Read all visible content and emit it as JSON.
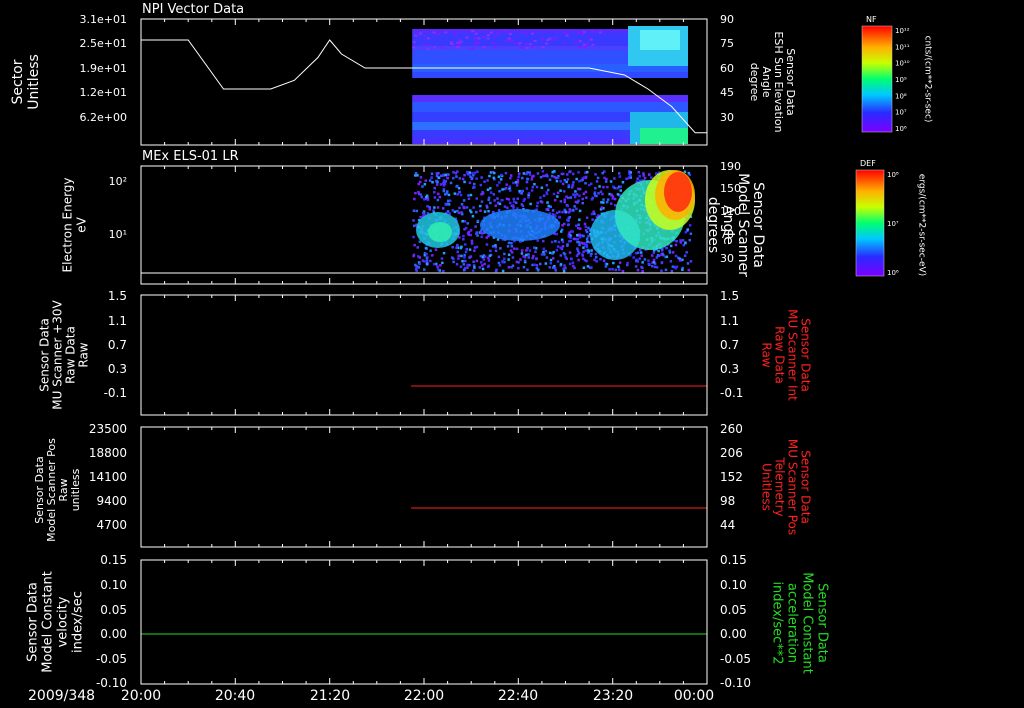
{
  "colors": {
    "background": "#000000",
    "frame": "#ffffff",
    "red_trace": "#ff2020",
    "green_trace": "#22dd22"
  },
  "time_axis": {
    "date_label": "2009/348",
    "ticks": [
      "20:00",
      "20:40",
      "21:20",
      "22:00",
      "22:40",
      "23:20",
      "00:00"
    ]
  },
  "chart_data": [
    {
      "type": "heatmap",
      "title": "NPI Vector Data",
      "ylabel_lines": [
        "Sector",
        "Unitless"
      ],
      "yticks": [
        "3.1e+01",
        "2.5e+01",
        "1.9e+01",
        "1.2e+01",
        "6.2e+00"
      ],
      "y2label_lines": [
        "Sensor Data",
        "ESH Sun Elevation",
        "Angle",
        "degree"
      ],
      "y2ticks": [
        "90",
        "75",
        "60",
        "45",
        "30"
      ],
      "y2lim": [
        18,
        90
      ],
      "colorbar": {
        "title": "NF",
        "unit": "cnts/(cm**2-sr-sec)",
        "ticks": [
          "10¹²",
          "10¹¹",
          "10¹⁰",
          "10⁹",
          "10⁸",
          "10⁷",
          "10⁶"
        ]
      },
      "data_start_time": "21:55",
      "line_series": {
        "name": "ESH Sun Elevation Angle",
        "times": [
          "20:00",
          "20:20",
          "20:35",
          "20:55",
          "21:05",
          "21:15",
          "21:20",
          "21:25",
          "21:35",
          "21:55",
          "22:30",
          "23:10",
          "23:25",
          "23:35",
          "23:45",
          "23:55",
          "00:00"
        ],
        "values": [
          78,
          78,
          50,
          50,
          55,
          68,
          78,
          70,
          62,
          62,
          62,
          62,
          58,
          50,
          40,
          25,
          25
        ]
      }
    },
    {
      "type": "heatmap",
      "title": "MEx ELS-01 LR",
      "ylabel_lines": [
        "Electron Energy",
        "eV"
      ],
      "yticks": [
        "10²",
        "10¹"
      ],
      "y2label_lines": [
        "Sensor Data",
        "Model Scanner",
        "Angle",
        "degrees"
      ],
      "y2ticks": [
        "190",
        "150",
        "110",
        "70",
        "30"
      ],
      "colorbar": {
        "title": "DEF",
        "unit": "ergs/(cm**2-sr-sec-eV)",
        "ticks": [
          "10⁸",
          "10⁷",
          "10⁶"
        ]
      },
      "data_start_time": "21:55",
      "line_series": {
        "name": "Model Scanner Angle",
        "value": 0
      }
    },
    {
      "type": "line",
      "ylabel_lines": [
        "Sensor Data",
        "MU Scanner +30V",
        "Raw Data",
        "Raw"
      ],
      "yticks": [
        "1.5",
        "1.1",
        "0.7",
        "0.3",
        "-0.1"
      ],
      "ylim": [
        -0.5,
        1.5
      ],
      "y2label_lines": [
        "Sensor Data",
        "MU Scanner Int",
        "Raw Data",
        "Raw"
      ],
      "y2ticks": [
        "1.5",
        "1.1",
        "0.7",
        "0.3",
        "-0.1"
      ],
      "series": [
        {
          "start": "21:55",
          "end": "00:00",
          "value": 0.0
        }
      ]
    },
    {
      "type": "line",
      "ylabel_lines": [
        "Sensor Data",
        "Model Scanner Pos",
        "Raw",
        "unitless"
      ],
      "yticks": [
        "23500",
        "18800",
        "14100",
        "9400",
        "4700"
      ],
      "ylim": [
        0,
        23500
      ],
      "y2label_lines": [
        "Sensor Data",
        "MU Scanner Pos",
        "Telemetry",
        "Unitless"
      ],
      "y2ticks": [
        "260",
        "206",
        "152",
        "98",
        "44"
      ],
      "series": [
        {
          "start": "21:55",
          "end": "00:00",
          "value": 8700
        }
      ]
    },
    {
      "type": "line",
      "ylabel_lines": [
        "Sensor Data",
        "Model Constant",
        "velocity",
        "index/sec"
      ],
      "yticks": [
        "0.15",
        "0.10",
        "0.05",
        "0.00",
        "-0.05",
        "-0.10"
      ],
      "ylim": [
        -0.1,
        0.15
      ],
      "y2label_lines": [
        "Sensor Data",
        "Model Constant",
        "acceleration",
        "index/sec**2"
      ],
      "y2ticks": [
        "0.15",
        "0.10",
        "0.05",
        "0.00",
        "-0.05",
        "-0.10"
      ],
      "series": [
        {
          "start": "20:00",
          "end": "00:00",
          "value": 0.0
        }
      ]
    }
  ]
}
